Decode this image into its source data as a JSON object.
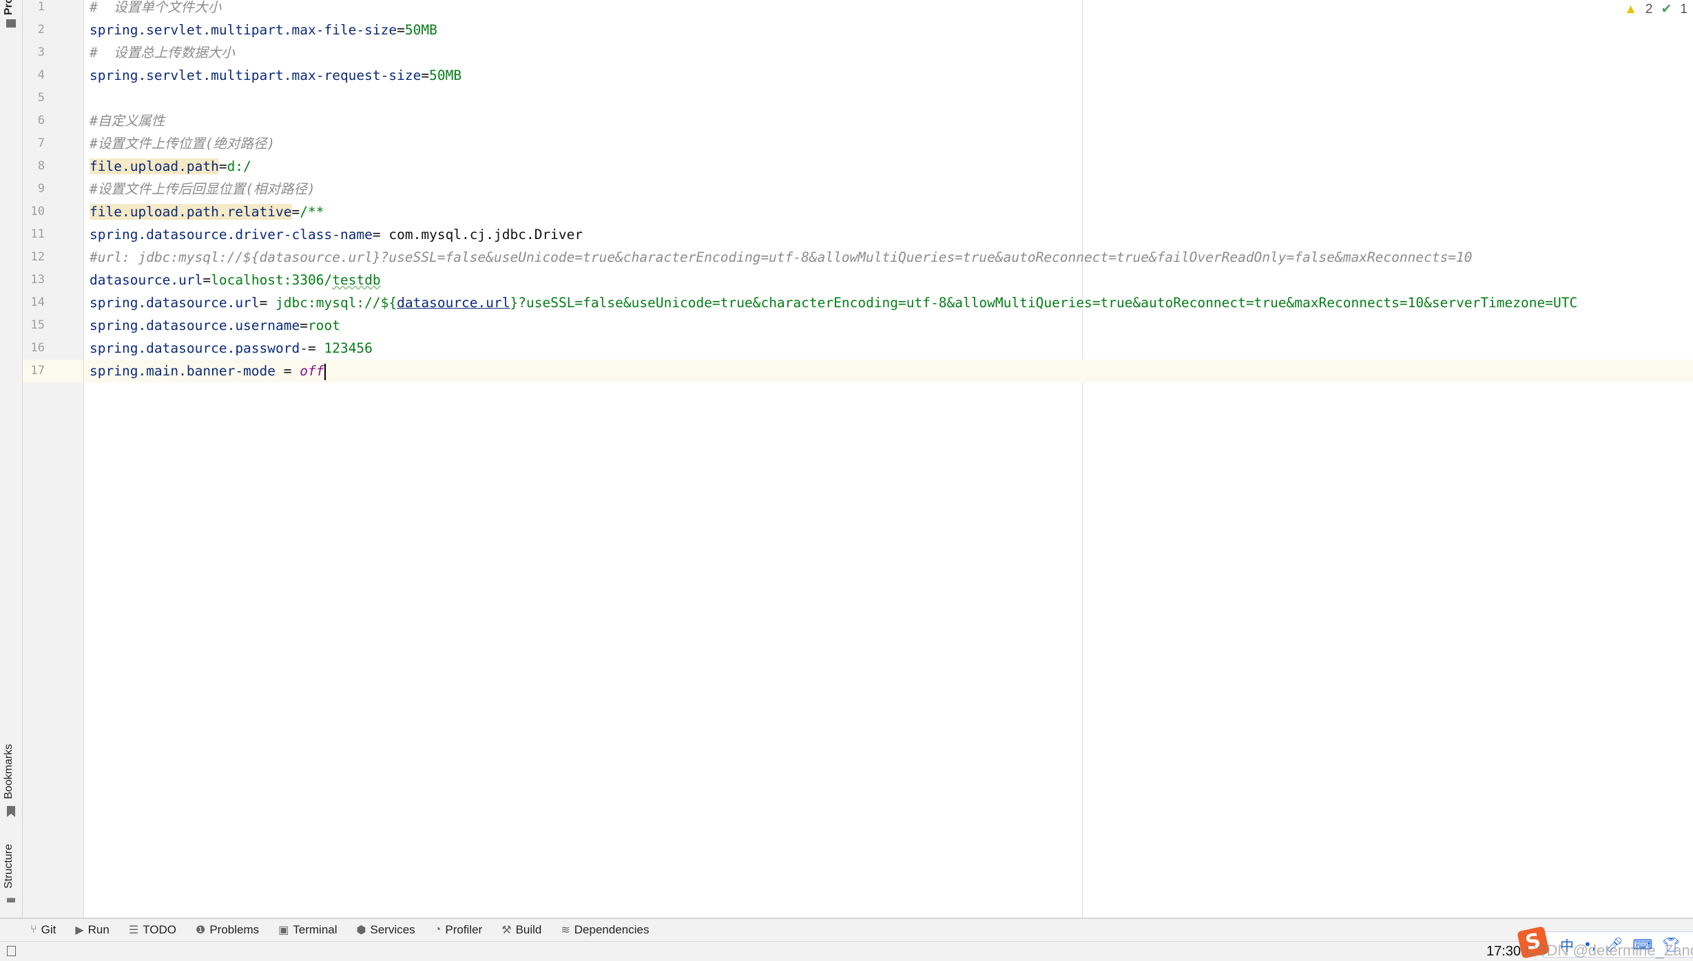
{
  "left_strip": {
    "project_label": "Pro",
    "bookmarks_label": "Bookmarks",
    "structure_label": "Structure"
  },
  "inspections": {
    "warnings": "2",
    "typos": "1"
  },
  "current_line": 17,
  "lines": [
    [
      {
        "t": "#  设置单个文件大小",
        "c": "c"
      }
    ],
    [
      {
        "t": "spring.servlet.multipart.max-file-size",
        "c": "k"
      },
      {
        "t": "=",
        "c": "p"
      },
      {
        "t": "50MB",
        "c": "v"
      }
    ],
    [
      {
        "t": "#  设置总上传数据大小",
        "c": "c"
      }
    ],
    [
      {
        "t": "spring.servlet.multipart.max-request-size",
        "c": "k"
      },
      {
        "t": "=",
        "c": "p"
      },
      {
        "t": "50MB",
        "c": "v"
      }
    ],
    [],
    [
      {
        "t": "#自定义属性",
        "c": "c"
      }
    ],
    [
      {
        "t": "#设置文件上传位置(绝对路径)",
        "c": "c"
      }
    ],
    [
      {
        "t": "file.upload.path",
        "c": "k h"
      },
      {
        "t": "=",
        "c": "p"
      },
      {
        "t": "d:/",
        "c": "v"
      }
    ],
    [
      {
        "t": "#设置文件上传后回显位置(相对路径)",
        "c": "c"
      }
    ],
    [
      {
        "t": "file.upload.path.relative",
        "c": "k h"
      },
      {
        "t": "=",
        "c": "p"
      },
      {
        "t": "/**",
        "c": "v"
      }
    ],
    [
      {
        "t": "spring.datasource.driver-class-name",
        "c": "k"
      },
      {
        "t": "= com.mysql.cj.jdbc.Driver",
        "c": "p"
      }
    ],
    [
      {
        "t": "#url: jdbc:mysql://${datasource.url}?useSSL=false&useUnicode=true&characterEncoding=utf-8&allowMultiQueries=true&autoReconnect=true&failOverReadOnly=false&maxReconnects=10",
        "c": "c"
      }
    ],
    [
      {
        "t": "datasource.url",
        "c": "k"
      },
      {
        "t": "=",
        "c": "p"
      },
      {
        "t": "localhost:3306/",
        "c": "v"
      },
      {
        "t": "testdb",
        "c": "v w"
      }
    ],
    [
      {
        "t": "spring.datasource.url",
        "c": "k"
      },
      {
        "t": "= ",
        "c": "p"
      },
      {
        "t": "jdbc:mysql://${",
        "c": "v"
      },
      {
        "t": "datasource.url",
        "c": "k u"
      },
      {
        "t": "}?useSSL=false&useUnicode=true&characterEncoding=utf-8&allowMultiQueries=true&autoReconnect=true&maxReconnects=10&serverTimezone=UTC",
        "c": "v"
      }
    ],
    [
      {
        "t": "spring.datasource.username",
        "c": "k"
      },
      {
        "t": "=",
        "c": "p"
      },
      {
        "t": "root",
        "c": "v"
      }
    ],
    [
      {
        "t": "spring.datasource.password-",
        "c": "k"
      },
      {
        "t": "= ",
        "c": "p"
      },
      {
        "t": "123456",
        "c": "v"
      }
    ],
    [
      {
        "t": "spring.main.banner-mode",
        "c": "k"
      },
      {
        "t": " = ",
        "c": "p"
      },
      {
        "t": "off",
        "c": "o"
      }
    ]
  ],
  "tool_windows": [
    {
      "label": "Git",
      "icon": "git-branch-icon",
      "glyph": "⑂"
    },
    {
      "label": "Run",
      "icon": "run-icon",
      "glyph": "▶"
    },
    {
      "label": "TODO",
      "icon": "list-icon",
      "glyph": "☰"
    },
    {
      "label": "Problems",
      "icon": "problems-icon",
      "glyph": "❶"
    },
    {
      "label": "Terminal",
      "icon": "terminal-icon",
      "glyph": "▣"
    },
    {
      "label": "Services",
      "icon": "services-icon",
      "glyph": "⬢"
    },
    {
      "label": "Profiler",
      "icon": "profiler-icon",
      "glyph": "◔"
    },
    {
      "label": "Build",
      "icon": "hammer-icon",
      "glyph": "⚒"
    },
    {
      "label": "Dependencies",
      "icon": "layers-icon",
      "glyph": "≋"
    }
  ],
  "status": {
    "time": "17:30",
    "watermark": "CSDN @determine_ZandR"
  },
  "ime": {
    "logo": "S",
    "mode": "中"
  }
}
